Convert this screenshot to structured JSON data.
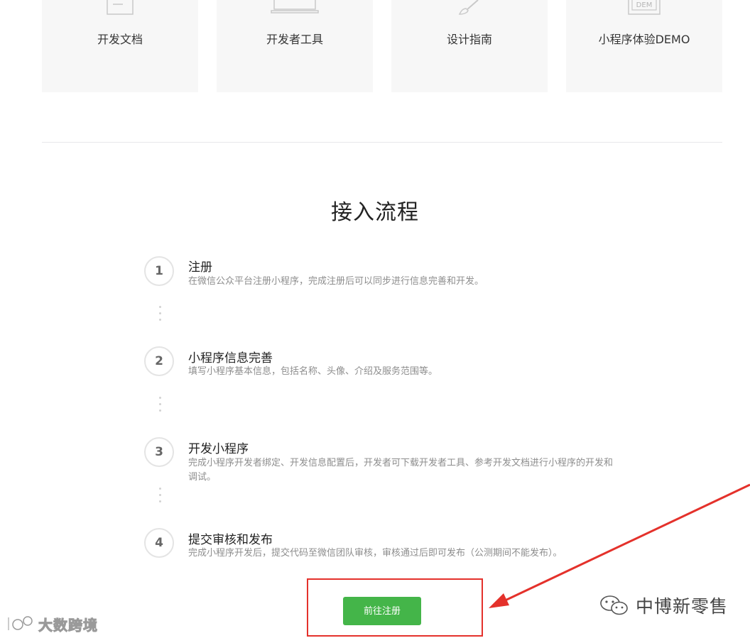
{
  "cards": [
    {
      "label": "开发文档",
      "icon": "document-icon"
    },
    {
      "label": "开发者工具",
      "icon": "laptop-icon"
    },
    {
      "label": "设计指南",
      "icon": "paintbrush-icon"
    },
    {
      "label": "小程序体验DEMO",
      "icon": "demo-icon",
      "icon_text": "DEM"
    }
  ],
  "section": {
    "title": "接入流程"
  },
  "steps": [
    {
      "number": "1",
      "title": "注册",
      "desc": "在微信公众平台注册小程序，完成注册后可以同步进行信息完善和开发。"
    },
    {
      "number": "2",
      "title": "小程序信息完善",
      "desc": "填写小程序基本信息，包括名称、头像、介绍及服务范围等。"
    },
    {
      "number": "3",
      "title": "开发小程序",
      "desc": "完成小程序开发者绑定、开发信息配置后，开发者可下载开发者工具、参考开发文档进行小程序的开发和调试。"
    },
    {
      "number": "4",
      "title": "提交审核和发布",
      "desc": "完成小程序开发后，提交代码至微信团队审核，审核通过后即可发布（公测期间不能发布）。"
    }
  ],
  "register_button": {
    "label": "前往注册",
    "color": "#44b549"
  },
  "annotation": {
    "color": "#e4312b"
  },
  "watermarks": {
    "left": "大数跨境",
    "right": "中博新零售"
  }
}
